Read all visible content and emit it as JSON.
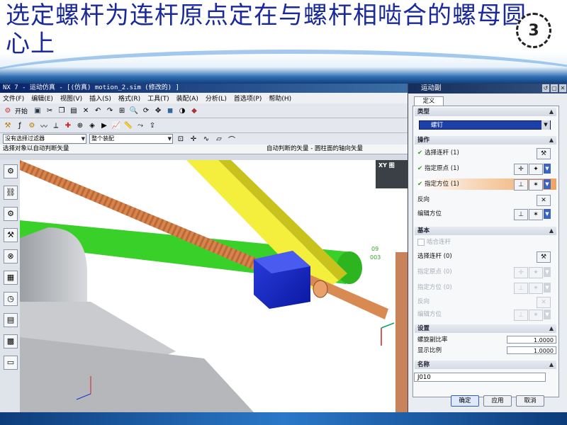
{
  "slide": {
    "title": "选定螺杆为连杆原点定在与螺杆相啮合的螺母圆心上",
    "logo_number": "3"
  },
  "window": {
    "title": "NX 7 - 运动仿真 - [(仿真) motion_2.sim (修改的) ]",
    "menu": [
      "文件(F)",
      "编辑(E)",
      "视图(V)",
      "插入(S)",
      "格式(R)",
      "工具(T)",
      "装配(A)",
      "分析(L)",
      "首选项(P)",
      "帮助(H)"
    ],
    "start_label": "开始",
    "filter": "没有选择过滤器",
    "assembly_scope": "整个装配",
    "prompt": "选择对象以自动判断矢量",
    "status": "自动判断的矢量 - 圆柱面的轴向矢量",
    "floating_dialog_title": "XY 图"
  },
  "viewport_labels": {
    "csys_label_1": "09",
    "csys_label_2": "003"
  },
  "dialog": {
    "title": "运动副",
    "tab": "定义",
    "type_group": "类型",
    "type_value": "螺钉",
    "action_group": "操作",
    "select_link": "选择连杆 (1)",
    "specify_origin": "指定原点 (1)",
    "specify_orientation": "指定方位 (1)",
    "reverse": "反向",
    "edit_orientation": "编辑方位",
    "base_group": "基本",
    "snap_link": "啮合连杆",
    "select_link_base": "选择连杆 (0)",
    "specify_origin_base": "指定原点 (0)",
    "specify_orientation_base": "指定方位 (0)",
    "reverse_base": "反向",
    "edit_orientation_base": "编辑方位",
    "settings_group": "设置",
    "screw_ratio_label": "螺旋副比率",
    "screw_ratio": "1.0000",
    "display_scale_label": "显示比例",
    "display_scale": "1.0000",
    "name_group": "名称",
    "name_value": "J010",
    "ok": "确定",
    "apply": "应用",
    "cancel": "取消"
  },
  "colors": {
    "title_text": "#1a2a9a",
    "screw": "#d98a52",
    "nut": "#1428c8",
    "yellow_link": "#f4ee3c",
    "green_link": "#3ad02a",
    "base": "#c4c6c9"
  }
}
